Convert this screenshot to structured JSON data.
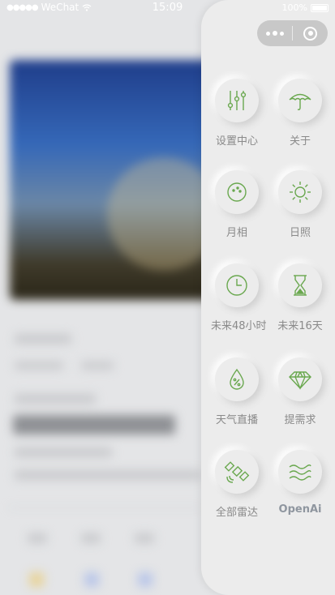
{
  "status_bar": {
    "carrier": "WeChat",
    "time": "15:09",
    "battery": "100%"
  },
  "capsule": {
    "more_icon": "more-dots-icon",
    "close_icon": "close-circle-icon"
  },
  "accent_color": "#6aa84f",
  "menu": [
    {
      "label": "设置中心",
      "icon": "sliders-icon"
    },
    {
      "label": "关于",
      "icon": "umbrella-icon"
    },
    {
      "label": "月相",
      "icon": "moon-face-icon"
    },
    {
      "label": "日照",
      "icon": "sun-icon"
    },
    {
      "label": "未来48小时",
      "icon": "clock-icon"
    },
    {
      "label": "未来16天",
      "icon": "hourglass-icon"
    },
    {
      "label": "天气直播",
      "icon": "humidity-drop-icon"
    },
    {
      "label": "提需求",
      "icon": "diamond-icon"
    },
    {
      "label": "全部雷达",
      "icon": "satellite-icon"
    },
    {
      "label": "OpenAi",
      "icon": "waves-icon"
    }
  ]
}
